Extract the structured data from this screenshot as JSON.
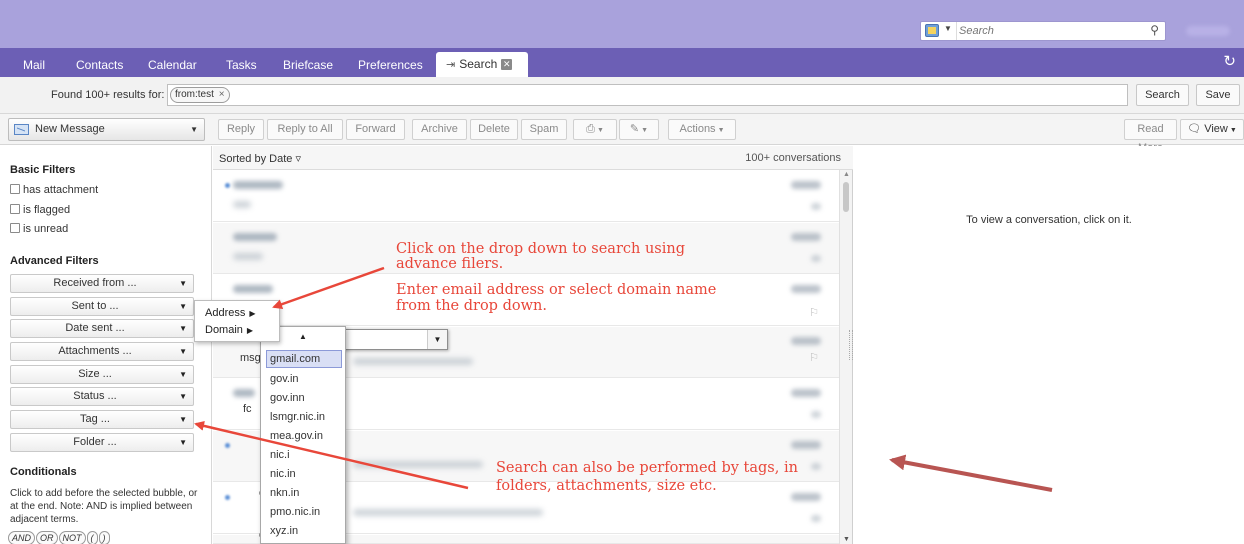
{
  "search": {
    "placeholder": "Search",
    "search_icon": "magnifier-icon",
    "type_icon": "search-scope-icon"
  },
  "tabs": [
    {
      "label": "Mail"
    },
    {
      "label": "Contacts"
    },
    {
      "label": "Calendar"
    },
    {
      "label": "Tasks"
    },
    {
      "label": "Briefcase"
    },
    {
      "label": "Preferences"
    }
  ],
  "active_tab": {
    "label": "Search",
    "pin_glyph": "⇥",
    "close_glyph": "✕"
  },
  "refresh_glyph": "↻",
  "query": {
    "found_label": "Found 100+ results for:",
    "bubble": "from:test",
    "bubble_remove": "×",
    "search_button": "Search",
    "save_button": "Save"
  },
  "toolbar": {
    "new_message": "New Message",
    "reply": "Reply",
    "reply_all": "Reply to All",
    "forward": "Forward",
    "archive": "Archive",
    "delete": "Delete",
    "spam": "Spam",
    "print_icon": "printer-icon",
    "tag_icon": "tag-icon",
    "actions": "Actions",
    "read_more": "Read More",
    "view": "View"
  },
  "filters": {
    "basic_title": "Basic Filters",
    "basic": [
      "has attachment",
      "is flagged",
      "is unread"
    ],
    "advanced_title": "Advanced Filters",
    "advanced": [
      "Received from ...",
      "Sent to ...",
      "Date sent ...",
      "Attachments ...",
      "Size ...",
      "Status ...",
      "Tag ...",
      "Folder ..."
    ],
    "conditionals_title": "Conditionals",
    "conditionals_help": "Click to add before the selected bubble, or at the end. Note: AND is implied between adjacent terms.",
    "operators": [
      "AND",
      "OR",
      "NOT",
      "(",
      ")"
    ]
  },
  "list": {
    "sort_label": "Sorted by Date",
    "sort_glyph": "▿",
    "count": "100+ conversations",
    "snippets": {
      "row4": "msgfi",
      "row5": "U",
      "row5b": "fc",
      "row7": "e",
      "row9": "e"
    }
  },
  "reading_pane": {
    "hint": "To view a conversation, click on it."
  },
  "submenu": {
    "address": "Address",
    "domain": "Domain"
  },
  "domains": [
    "gmail.com",
    "gov.in",
    "gov.inn",
    "lsmgr.nic.in",
    "mea.gov.in",
    "nic.i",
    "nic.in",
    "nkn.in",
    "pmo.nic.in",
    "xyz.in"
  ],
  "annotations": {
    "top": [
      "Click on the drop down to search using",
      "advance filers.",
      "Enter email address or select domain name",
      "from the drop down."
    ],
    "bottom": [
      "Search can also be performed by tags, in",
      "folders, attachments, size etc."
    ]
  },
  "colors": {
    "topbar": "#a9a2dc",
    "tabbar": "#6c5fb5",
    "annotation": "#e8473a",
    "annotation_arrow_right": "#b85552"
  }
}
